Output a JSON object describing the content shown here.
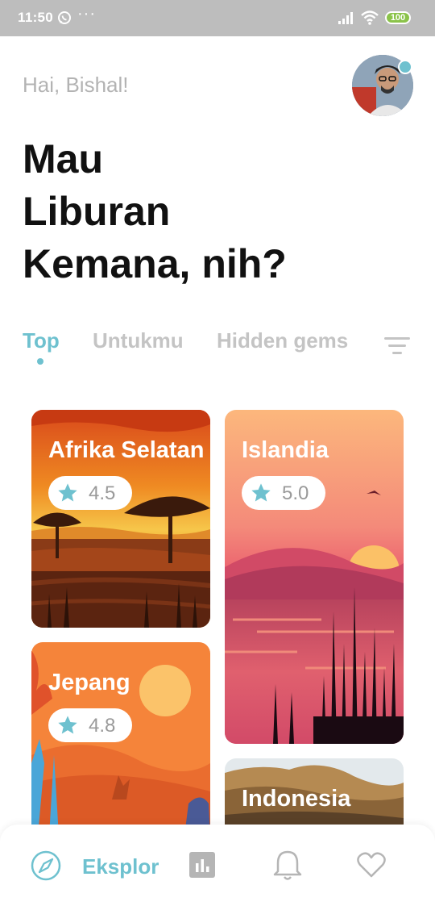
{
  "status_bar": {
    "time": "11:50",
    "dots": "···",
    "battery": "100"
  },
  "header": {
    "greeting": "Hai, Bishal!",
    "headline": [
      "Mau",
      "Liburan",
      "Kemana, nih?"
    ]
  },
  "tabs": [
    {
      "label": "Top",
      "active": true
    },
    {
      "label": "Untukmu",
      "active": false
    },
    {
      "label": "Hidden gems",
      "active": false
    }
  ],
  "destinations": [
    {
      "name": "Afrika Selatan",
      "rating": "4.5"
    },
    {
      "name": "Islandia",
      "rating": "5.0"
    },
    {
      "name": "Jepang",
      "rating": "4.8"
    },
    {
      "name": "Indonesia",
      "rating": ""
    }
  ],
  "bottom_nav": {
    "active_label": "Eksplor",
    "items": [
      "compass-icon",
      "stats-icon",
      "bell-icon",
      "heart-icon"
    ]
  },
  "colors": {
    "accent": "#6ec1cf",
    "inactive": "#c4c4c4"
  }
}
